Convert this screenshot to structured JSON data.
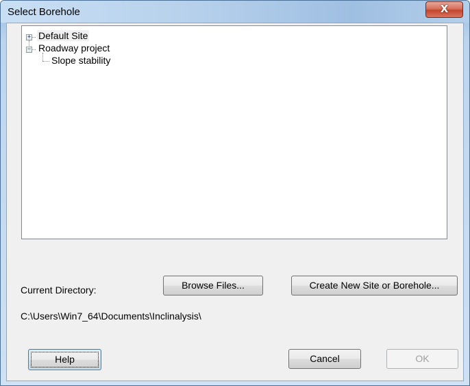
{
  "window": {
    "title": "Select Borehole",
    "close_glyph": "X"
  },
  "tree": {
    "nodes": [
      {
        "label": "Default Site",
        "expander": "+",
        "selected": true
      },
      {
        "label": "Roadway project",
        "expander": "−"
      },
      {
        "label": "Slope stability"
      }
    ]
  },
  "directory": {
    "label": "Current Directory:",
    "path": "C:\\Users\\Win7_64\\Documents\\Inclinalysis\\"
  },
  "buttons": {
    "browse": "Browse Files...",
    "create": "Create New Site or Borehole...",
    "help": "Help",
    "cancel": "Cancel",
    "ok": "OK"
  },
  "icons": {
    "close": "close-icon",
    "expand": "plus-box-icon",
    "collapse": "minus-box-icon"
  }
}
